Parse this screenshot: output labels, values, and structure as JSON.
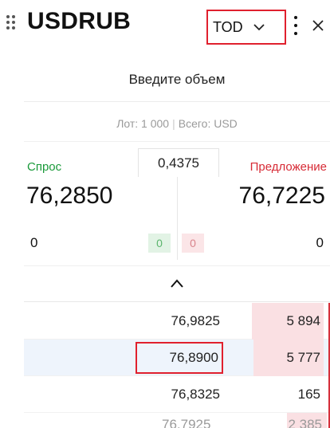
{
  "header": {
    "title": "USDRUB",
    "term": "TOD",
    "icons": [
      "drag-handle-icon",
      "chevron-down-icon",
      "more-vertical-icon",
      "close-icon"
    ]
  },
  "volume": {
    "placeholder": "Введите объем"
  },
  "lot": {
    "lot_text": "Лот: 1 000",
    "total_text": "Всего: USD"
  },
  "quote": {
    "bid_label": "Спрос",
    "ask_label": "Предложение",
    "spread": "0,4375",
    "bid_price": "76,2850",
    "ask_price": "76,7225",
    "bid_qty": "0",
    "ask_qty": "0",
    "bid_badge": "0",
    "ask_badge": "0"
  },
  "order_book": [
    {
      "price": "76,9825",
      "volume": "5 894",
      "fill": 0.75
    },
    {
      "price": "76,8900",
      "volume": "5 777",
      "fill": 0.73
    },
    {
      "price": "76,8325",
      "volume": "165",
      "fill": 0
    }
  ],
  "order_book_partial": {
    "price": "76,7925",
    "volume": "2 385"
  },
  "colors": {
    "bid": "#1a9a3a",
    "ask": "#d72b36",
    "highlight_border": "#e0202e",
    "selected_row": "#eef4fc",
    "ask_bar": "#fae0e3"
  }
}
